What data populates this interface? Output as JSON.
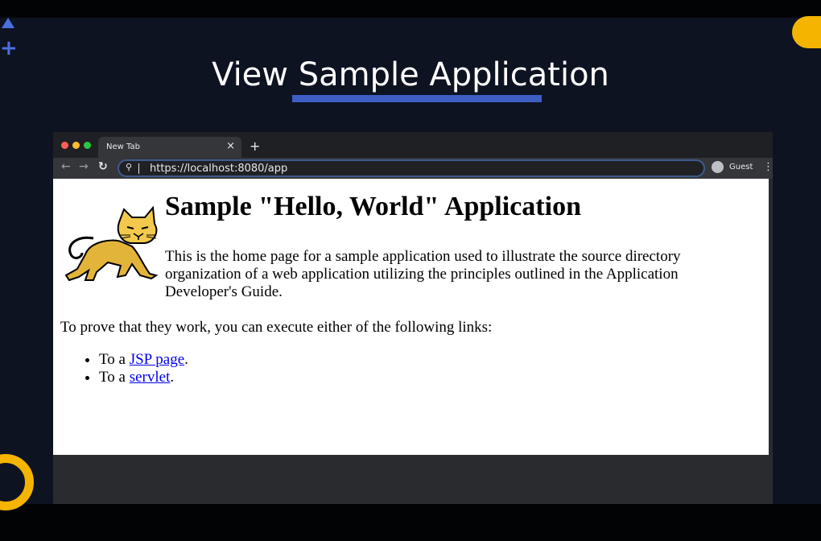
{
  "slide": {
    "title": "View Sample Application",
    "accent_color": "#3d5fc4",
    "highlight_color": "#f4b400"
  },
  "browser": {
    "tab": {
      "label": "New Tab",
      "close_icon": "close-icon"
    },
    "new_tab_icon": "plus-icon",
    "address": {
      "url": "https://localhost:8080/app"
    },
    "profile": {
      "label": "Guest"
    }
  },
  "page": {
    "heading": "Sample \"Hello, World\" Application",
    "intro": "This is the home page for a sample application used to illustrate the source directory organization of a web application utilizing the principles outlined in the Application Developer's Guide.",
    "prove_text": "To prove that they work, you can execute either of the following links:",
    "links": [
      {
        "prefix": "To a ",
        "link_text": "JSP page",
        "suffix": "."
      },
      {
        "prefix": "To a ",
        "link_text": "servlet",
        "suffix": "."
      }
    ],
    "logo_icon": "tomcat-cat-logo"
  }
}
